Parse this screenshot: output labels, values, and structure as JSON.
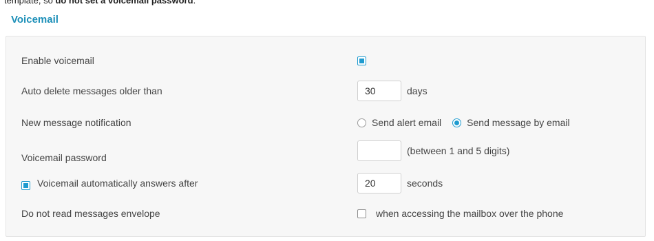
{
  "top_snippet": {
    "prefix": "template, so ",
    "bold": "do not set a voicemail password",
    "suffix": "."
  },
  "section": {
    "title": "Voicemail"
  },
  "rows": {
    "enable": {
      "label": "Enable voicemail",
      "checked": true
    },
    "auto_delete": {
      "label": "Auto delete messages older than",
      "value": "30",
      "unit": "days"
    },
    "notification": {
      "label": "New message notification",
      "options": [
        "Send alert email",
        "Send message by email"
      ],
      "selected": "Send message by email"
    },
    "password": {
      "label": "Voicemail password",
      "value": "",
      "hint": "(between 1 and 5 digits)"
    },
    "auto_answer": {
      "label": "Voicemail automatically answers after",
      "checked": true,
      "value": "20",
      "unit": "seconds"
    },
    "envelope": {
      "label": "Do not read messages envelope",
      "checkbox_label": "when accessing the mailbox over the phone",
      "checked": false
    }
  },
  "colors": {
    "accent": "#1f9bcf",
    "title": "#1c8fb8",
    "panel_bg": "#f7f7f7"
  }
}
